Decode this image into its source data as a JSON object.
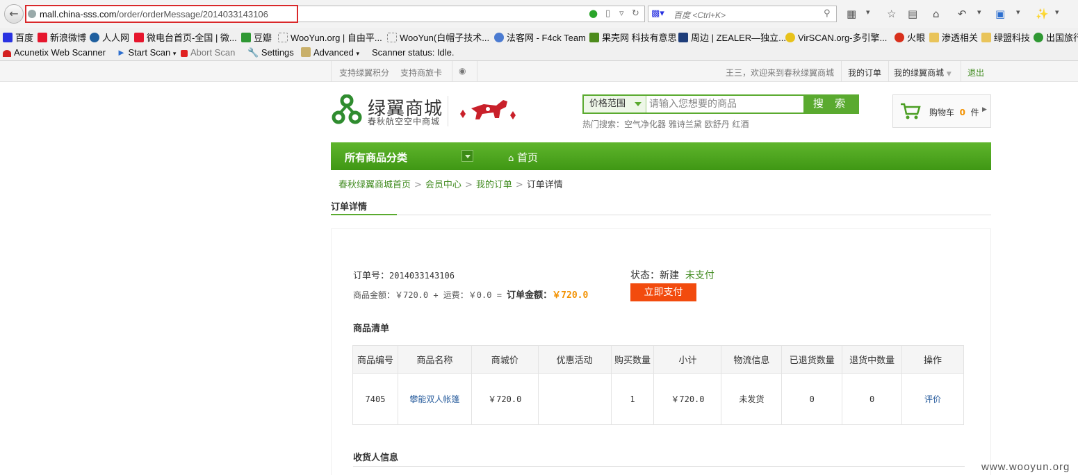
{
  "browser": {
    "url_host": "mall.china-sss.com",
    "url_path": "/order/orderMessage/2014033143106",
    "search_placeholder": "百度 <Ctrl+K>"
  },
  "bookmarks": [
    {
      "label": "百度",
      "icon": "baidu-icon",
      "color": "#2932e1"
    },
    {
      "label": "新浪微博",
      "icon": "weibo-icon",
      "color": "#e6162d"
    },
    {
      "label": "人人网",
      "icon": "renren-icon",
      "color": "#1f5f9e"
    },
    {
      "label": "微电台首页-全国 | 微...",
      "icon": "weibo-icon",
      "color": "#e6162d"
    },
    {
      "label": "豆瓣",
      "icon": "douban-icon",
      "color": "#2f9833"
    },
    {
      "label": "WooYun.org | 自由平...",
      "icon": "page-icon",
      "color": "#ffffff"
    },
    {
      "label": "WooYun(白帽子技术...",
      "icon": "page-icon",
      "color": "#ffffff"
    },
    {
      "label": "法客网 - F4ck Team",
      "icon": "f4ck-icon",
      "color": "#4b7bd1"
    },
    {
      "label": "果壳网 科技有意思",
      "icon": "guokr-icon",
      "color": "#4d8b1c"
    },
    {
      "label": "周边 | ZEALER—独立...",
      "icon": "zealer-icon",
      "color": "#1e3d7a"
    },
    {
      "label": "VirSCAN.org-多引擎...",
      "icon": "virscan-icon",
      "color": "#e8c21a"
    },
    {
      "label": "火眼",
      "icon": "huoyan-icon",
      "color": "#d8301c"
    },
    {
      "label": "渗透相关",
      "icon": "folder-icon",
      "color": "#e9c45a"
    },
    {
      "label": "绿盟科技",
      "icon": "folder-icon",
      "color": "#e9c45a"
    },
    {
      "label": "出国旅行",
      "icon": "travel-icon",
      "color": "#2f9833"
    }
  ],
  "acunetix": {
    "title": "Acunetix Web Scanner",
    "start": "Start Scan",
    "abort": "Abort Scan",
    "settings": "Settings",
    "advanced": "Advanced",
    "status": "Scanner status: Idle."
  },
  "topbar": {
    "support_points": "支持绿翼积分",
    "support_card": "支持商旅卡",
    "welcome": "王三，欢迎来到春秋绿翼商城",
    "my_orders": "我的订单",
    "my_mall": "我的绿翼商城",
    "logout": "退出"
  },
  "header": {
    "logo_title": "绿翼商城",
    "logo_sub": "春秋航空空中商城",
    "search_range": "价格范围",
    "search_placeholder": "请输入您想要的商品",
    "search_button": "搜 索",
    "hot_label": "热门搜索：",
    "hot_terms": "空气净化器 雅诗兰黛 欧舒丹 红酒",
    "cart_label": "购物车",
    "cart_count": "0",
    "cart_unit": "件"
  },
  "nav": {
    "all_categories": "所有商品分类",
    "home": "首页"
  },
  "breadcrumb": {
    "home": "春秋绿翼商城首页",
    "member": "会员中心",
    "orders": "我的订单",
    "current": "订单详情"
  },
  "order": {
    "tab_title": "订单详情",
    "number_label": "订单号：",
    "number": "2014033143106",
    "amount_line": "商品金额：￥720.0 + 运费：￥0.0 = ",
    "total_label": "订单金额：",
    "total": "￥720.0",
    "status_label": "状态：新建",
    "status_value": "未支付",
    "pay_button": "立即支付",
    "items_title": "商品清单",
    "consignee_title": "收货人信息"
  },
  "items_table": {
    "headers": [
      "商品编号",
      "商品名称",
      "商城价",
      "优惠活动",
      "购买数量",
      "小计",
      "物流信息",
      "已退货数量",
      "退货中数量",
      "操作"
    ],
    "rows": [
      [
        "7405",
        "攀能双人帐篷",
        "￥720.0",
        "",
        "1",
        "￥720.0",
        "未发货",
        "0",
        "0",
        "评价"
      ]
    ]
  },
  "colors": {
    "brand_green": "#5aaa2f",
    "pay_orange": "#f24b0e",
    "total_orange": "#f29100",
    "link_blue": "#2a5e9e",
    "highlight_red": "#d9282a"
  },
  "watermark": "www.wooyun.org"
}
